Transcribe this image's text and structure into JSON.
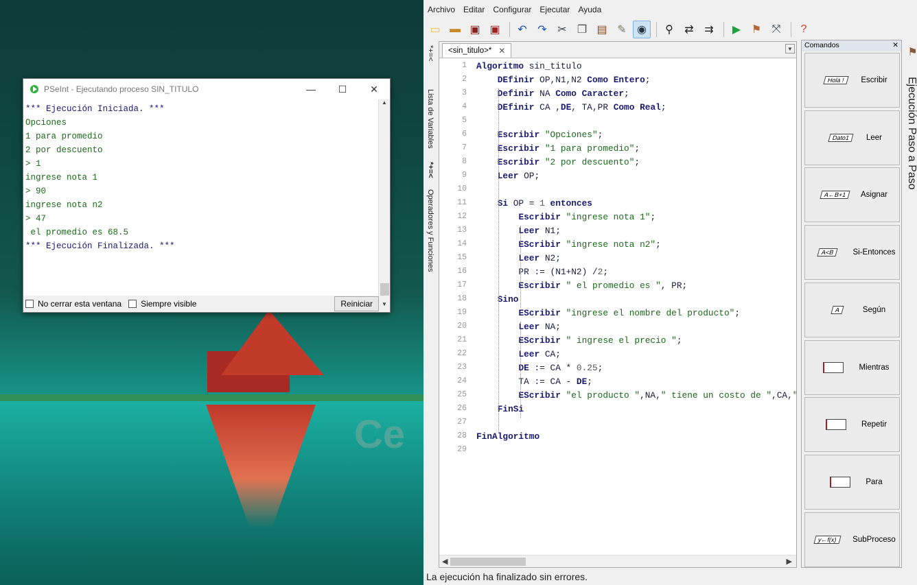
{
  "desktop": {
    "watermark": "Ce"
  },
  "console": {
    "title": "PSeInt - Ejecutando proceso SIN_TITULO",
    "lines": [
      "*** Ejecución Iniciada. ***",
      "Opciones",
      "1 para promedio",
      "2 por descuento",
      "> 1",
      "ingrese nota 1",
      "> 90",
      "ingrese nota n2",
      "> 47",
      " el promedio es 68.5",
      "*** Ejecución Finalizada. ***"
    ],
    "no_cerrar": "No cerrar esta ventana",
    "siempre_visible": "Siempre visible",
    "reiniciar": "Reiniciar"
  },
  "ide": {
    "menu": [
      "Archivo",
      "Editar",
      "Configurar",
      "Ejecutar",
      "Ayuda"
    ],
    "tab_label": "<sin_titulo>*",
    "left_labels": {
      "variables": "Lista de Variables",
      "operadores": "Operadores y Funciones",
      "var_glyphs": "*+=<",
      "op_glyphs": "*+=<"
    },
    "right_label": "Ejecución Paso a Paso",
    "commands_title": "Comandos",
    "commands": [
      {
        "label": "Escribir",
        "shape_text": "Hola !"
      },
      {
        "label": "Leer",
        "shape_text": "Dato1"
      },
      {
        "label": "Asignar",
        "shape_text": "A←B+1"
      },
      {
        "label": "Si-Entonces",
        "shape_text": "A<B"
      },
      {
        "label": "Según",
        "shape_text": "A"
      },
      {
        "label": "Mientras",
        "shape_text": ""
      },
      {
        "label": "Repetir",
        "shape_text": ""
      },
      {
        "label": "Para",
        "shape_text": ""
      },
      {
        "label": "SubProceso",
        "shape_text": "y←f(x)"
      }
    ],
    "status": "La ejecución ha finalizado sin errores."
  },
  "code": [
    "Algoritmo sin_titulo",
    "    DEfinir OP,N1,N2 Como Entero;",
    "    Definir NA Como Caracter;",
    "    DEfinir CA ,DE, TA,PR Como Real;",
    "",
    "    Escribir \"Opciones\";",
    "    Escribir \"1 para promedio\";",
    "    Escribir \"2 por descuento\";",
    "    Leer OP;",
    "",
    "    Si OP = 1 entonces",
    "        Escribir \"ingrese nota 1\";",
    "        Leer N1;",
    "        EScribir \"ingrese nota n2\";",
    "        Leer N2;",
    "        PR := (N1+N2) /2;",
    "        Escribir \" el promedio es \", PR;",
    "    Sino",
    "        EScribir \"ingrese el nombre del producto\";",
    "        Leer NA;",
    "        EScribir \" ingrese el precio \";",
    "        Leer CA;",
    "        DE := CA * 0.25;",
    "        TA := CA - DE;",
    "        EScribir \"el producto \",NA,\" tiene un costo de \",CA,\" ti",
    "    FinSi",
    "",
    "FinAlgoritmo",
    ""
  ]
}
